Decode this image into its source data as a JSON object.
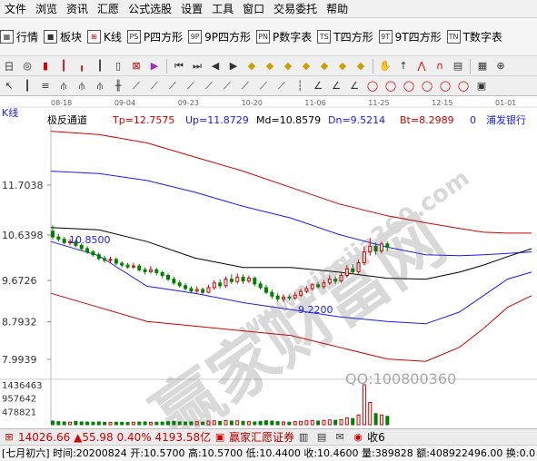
{
  "menu": [
    "文件",
    "浏览",
    "资讯",
    "汇愿",
    "公式选股",
    "设置",
    "工具",
    "窗口",
    "交易委托",
    "帮助"
  ],
  "toolbar1": [
    {
      "icon": "grid-icon",
      "label": "行情"
    },
    {
      "icon": "blocks-icon",
      "label": "板块"
    },
    {
      "icon": "candles-icon",
      "label": "K线"
    },
    {
      "icon": "ps-icon",
      "label": "P四方形",
      "badge": "PS"
    },
    {
      "icon": "9p-icon",
      "label": "9P四方形",
      "badge": "9P"
    },
    {
      "icon": "pn-icon",
      "label": "P数字表",
      "badge": "PN"
    },
    {
      "icon": "ts-icon",
      "label": "T四方形",
      "badge": "TS"
    },
    {
      "icon": "9t-icon",
      "label": "9T四方形",
      "badge": "9T"
    },
    {
      "icon": "tn-icon",
      "label": "T数字表",
      "badge": "TN"
    }
  ],
  "chart_data": {
    "type": "candlestick",
    "title_left": "K线",
    "indicator": "极反通道",
    "params": {
      "Tp": "Tp=12.7575",
      "Up": "Up=11.8729",
      "Md": "Md=10.8579",
      "Dn": "Dn=9.5214",
      "Bt": "Bt=8.2989"
    },
    "stock_label": "浦发银行",
    "code_prefix": "0",
    "date_ticks": [
      "08-18",
      "09-04",
      "09-23",
      "10-20",
      "11-06",
      "11-25",
      "12-15",
      "01-01"
    ],
    "price_ticks": [
      "11.7038",
      "10.6398",
      "9.6726",
      "8.7932",
      "7.9939"
    ],
    "volume_ticks": [
      "1436463",
      "957642",
      "478821"
    ],
    "annotations": {
      "high": "10.8500",
      "low": "9.2200"
    },
    "ylim": [
      7.8,
      12.9
    ],
    "volume_max": 1436463,
    "colors": {
      "up": "#d40000",
      "down": "#008000",
      "top": "#d40000",
      "upper": "#1a1aff",
      "mid": "#000000",
      "lower": "#1a1aff",
      "bottom": "#d40000",
      "volume": "#008000"
    },
    "channel": {
      "x_frac": [
        0,
        0.1,
        0.2,
        0.3,
        0.4,
        0.5,
        0.6,
        0.7,
        0.78,
        0.85,
        0.9,
        0.95,
        1.0
      ],
      "top": [
        12.85,
        12.78,
        12.6,
        12.3,
        12.0,
        11.65,
        11.3,
        11.05,
        10.9,
        10.78,
        10.7,
        10.68,
        10.68
      ],
      "upper": [
        12.0,
        11.95,
        11.8,
        11.55,
        11.25,
        11.0,
        10.65,
        10.38,
        10.22,
        10.2,
        10.22,
        10.25,
        10.28
      ],
      "mid": [
        10.8,
        10.75,
        10.5,
        10.15,
        9.95,
        9.95,
        9.85,
        9.72,
        9.7,
        9.85,
        10.0,
        10.18,
        10.35
      ],
      "lower": [
        10.5,
        10.2,
        9.55,
        9.4,
        9.2,
        9.05,
        8.9,
        8.8,
        8.75,
        9.0,
        9.35,
        9.7,
        9.85
      ],
      "bottom": [
        9.4,
        9.1,
        8.8,
        8.7,
        8.6,
        8.5,
        8.25,
        8.0,
        7.95,
        8.25,
        8.65,
        9.1,
        9.35
      ]
    },
    "candles": [
      {
        "o": 10.72,
        "c": 10.6,
        "h": 10.85,
        "l": 10.55
      },
      {
        "o": 10.6,
        "c": 10.55,
        "h": 10.66,
        "l": 10.5
      },
      {
        "o": 10.55,
        "c": 10.48,
        "h": 10.6,
        "l": 10.44
      },
      {
        "o": 10.48,
        "c": 10.5,
        "h": 10.56,
        "l": 10.42
      },
      {
        "o": 10.5,
        "c": 10.42,
        "h": 10.55,
        "l": 10.38
      },
      {
        "o": 10.42,
        "c": 10.35,
        "h": 10.47,
        "l": 10.3
      },
      {
        "o": 10.35,
        "c": 10.28,
        "h": 10.4,
        "l": 10.24
      },
      {
        "o": 10.28,
        "c": 10.22,
        "h": 10.32,
        "l": 10.18
      },
      {
        "o": 10.22,
        "c": 10.14,
        "h": 10.27,
        "l": 10.1
      },
      {
        "o": 10.14,
        "c": 10.1,
        "h": 10.2,
        "l": 10.05
      },
      {
        "o": 10.1,
        "c": 10.12,
        "h": 10.18,
        "l": 10.04
      },
      {
        "o": 10.12,
        "c": 10.04,
        "h": 10.16,
        "l": 10.0
      },
      {
        "o": 10.04,
        "c": 10.0,
        "h": 10.08,
        "l": 9.95
      },
      {
        "o": 10.0,
        "c": 9.96,
        "h": 10.04,
        "l": 9.92
      },
      {
        "o": 9.96,
        "c": 9.98,
        "h": 10.05,
        "l": 9.92
      },
      {
        "o": 9.98,
        "c": 9.9,
        "h": 10.02,
        "l": 9.86
      },
      {
        "o": 9.9,
        "c": 9.86,
        "h": 9.95,
        "l": 9.8
      },
      {
        "o": 9.86,
        "c": 9.9,
        "h": 9.98,
        "l": 9.82
      },
      {
        "o": 9.9,
        "c": 9.84,
        "h": 9.94,
        "l": 9.78
      },
      {
        "o": 9.84,
        "c": 9.78,
        "h": 9.88,
        "l": 9.72
      },
      {
        "o": 9.78,
        "c": 9.7,
        "h": 9.82,
        "l": 9.66
      },
      {
        "o": 9.7,
        "c": 9.62,
        "h": 9.76,
        "l": 9.58
      },
      {
        "o": 9.62,
        "c": 9.56,
        "h": 9.68,
        "l": 9.52
      },
      {
        "o": 9.56,
        "c": 9.5,
        "h": 9.62,
        "l": 9.46
      },
      {
        "o": 9.5,
        "c": 9.45,
        "h": 9.55,
        "l": 9.4
      },
      {
        "o": 9.45,
        "c": 9.48,
        "h": 9.55,
        "l": 9.4
      },
      {
        "o": 9.48,
        "c": 9.42,
        "h": 9.52,
        "l": 9.38
      },
      {
        "o": 9.42,
        "c": 9.52,
        "h": 9.58,
        "l": 9.4
      },
      {
        "o": 9.52,
        "c": 9.62,
        "h": 9.68,
        "l": 9.48
      },
      {
        "o": 9.62,
        "c": 9.56,
        "h": 9.7,
        "l": 9.5
      },
      {
        "o": 9.56,
        "c": 9.7,
        "h": 9.76,
        "l": 9.52
      },
      {
        "o": 9.7,
        "c": 9.65,
        "h": 9.8,
        "l": 9.6
      },
      {
        "o": 9.65,
        "c": 9.74,
        "h": 9.82,
        "l": 9.6
      },
      {
        "o": 9.74,
        "c": 9.66,
        "h": 9.8,
        "l": 9.6
      },
      {
        "o": 9.66,
        "c": 9.72,
        "h": 9.78,
        "l": 9.62
      },
      {
        "o": 9.72,
        "c": 9.6,
        "h": 9.76,
        "l": 9.55
      },
      {
        "o": 9.6,
        "c": 9.52,
        "h": 9.66,
        "l": 9.48
      },
      {
        "o": 9.52,
        "c": 9.42,
        "h": 9.58,
        "l": 9.38
      },
      {
        "o": 9.42,
        "c": 9.34,
        "h": 9.48,
        "l": 9.28
      },
      {
        "o": 9.34,
        "c": 9.28,
        "h": 9.4,
        "l": 9.22
      },
      {
        "o": 9.28,
        "c": 9.32,
        "h": 9.38,
        "l": 9.22
      },
      {
        "o": 9.32,
        "c": 9.3,
        "h": 9.36,
        "l": 9.25
      },
      {
        "o": 9.3,
        "c": 9.36,
        "h": 9.42,
        "l": 9.26
      },
      {
        "o": 9.36,
        "c": 9.44,
        "h": 9.5,
        "l": 9.32
      },
      {
        "o": 9.44,
        "c": 9.5,
        "h": 9.56,
        "l": 9.4
      },
      {
        "o": 9.5,
        "c": 9.58,
        "h": 9.62,
        "l": 9.46
      },
      {
        "o": 9.58,
        "c": 9.54,
        "h": 9.64,
        "l": 9.5
      },
      {
        "o": 9.54,
        "c": 9.62,
        "h": 9.68,
        "l": 9.5
      },
      {
        "o": 9.62,
        "c": 9.7,
        "h": 9.78,
        "l": 9.58
      },
      {
        "o": 9.7,
        "c": 9.66,
        "h": 9.76,
        "l": 9.6
      },
      {
        "o": 9.66,
        "c": 9.78,
        "h": 9.86,
        "l": 9.62
      },
      {
        "o": 9.78,
        "c": 9.92,
        "h": 10.0,
        "l": 9.74
      },
      {
        "o": 9.92,
        "c": 9.86,
        "h": 10.02,
        "l": 9.8
      },
      {
        "o": 9.86,
        "c": 10.05,
        "h": 10.12,
        "l": 9.82
      },
      {
        "o": 10.05,
        "c": 10.28,
        "h": 10.4,
        "l": 10.0
      },
      {
        "o": 10.28,
        "c": 10.4,
        "h": 10.58,
        "l": 10.2
      },
      {
        "o": 10.4,
        "c": 10.3,
        "h": 10.48,
        "l": 10.22
      },
      {
        "o": 10.3,
        "c": 10.45,
        "h": 10.5,
        "l": 10.25
      },
      {
        "o": 10.45,
        "c": 10.38,
        "h": 10.5,
        "l": 10.3
      }
    ],
    "volumes": [
      130000,
      110000,
      100000,
      90000,
      120000,
      100000,
      95000,
      90000,
      100000,
      85000,
      80000,
      90000,
      85000,
      80000,
      90000,
      95000,
      100000,
      85000,
      90000,
      95000,
      110000,
      120000,
      100000,
      95000,
      100000,
      110000,
      90000,
      130000,
      140000,
      120000,
      150000,
      130000,
      140000,
      120000,
      110000,
      100000,
      120000,
      140000,
      130000,
      110000,
      100000,
      90000,
      110000,
      120000,
      140000,
      150000,
      130000,
      150000,
      170000,
      160000,
      180000,
      250000,
      220000,
      350000,
      1436463,
      800000,
      400000,
      350000,
      300000
    ]
  },
  "watermark": {
    "text": "赢家财富网",
    "url": "www.yingjia360.com",
    "qq": "QQ:100800360"
  },
  "statusbar": {
    "index_value": "14026.66",
    "change": "▲55.98",
    "pct": "0.40%",
    "amount": "4193.58亿",
    "broker": "赢家汇愿证券",
    "right_label": "收6"
  },
  "infobar": "[七月初六] 时间:20200824 开:10.5700 高:10.5700 低:10.4400 收:10.4600 量:389828 额:408922496.00 换:0.0"
}
